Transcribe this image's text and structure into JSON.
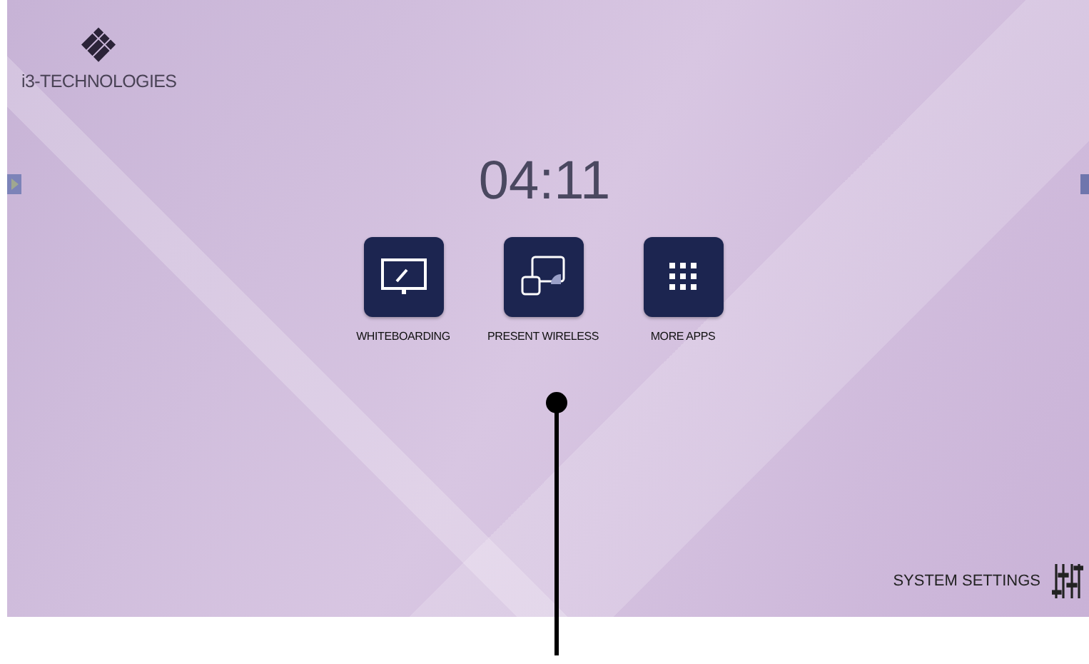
{
  "logo": {
    "text": "i3-TECHNOLOGIES"
  },
  "clock": "04:11",
  "apps": [
    {
      "kind": "whiteboard",
      "label": "WHITEBOARDING"
    },
    {
      "kind": "wireless",
      "label": "PRESENT WIRELESS"
    },
    {
      "kind": "grid",
      "label": "MORE APPS"
    }
  ],
  "settings": {
    "label": "SYSTEM SETTINGS"
  }
}
